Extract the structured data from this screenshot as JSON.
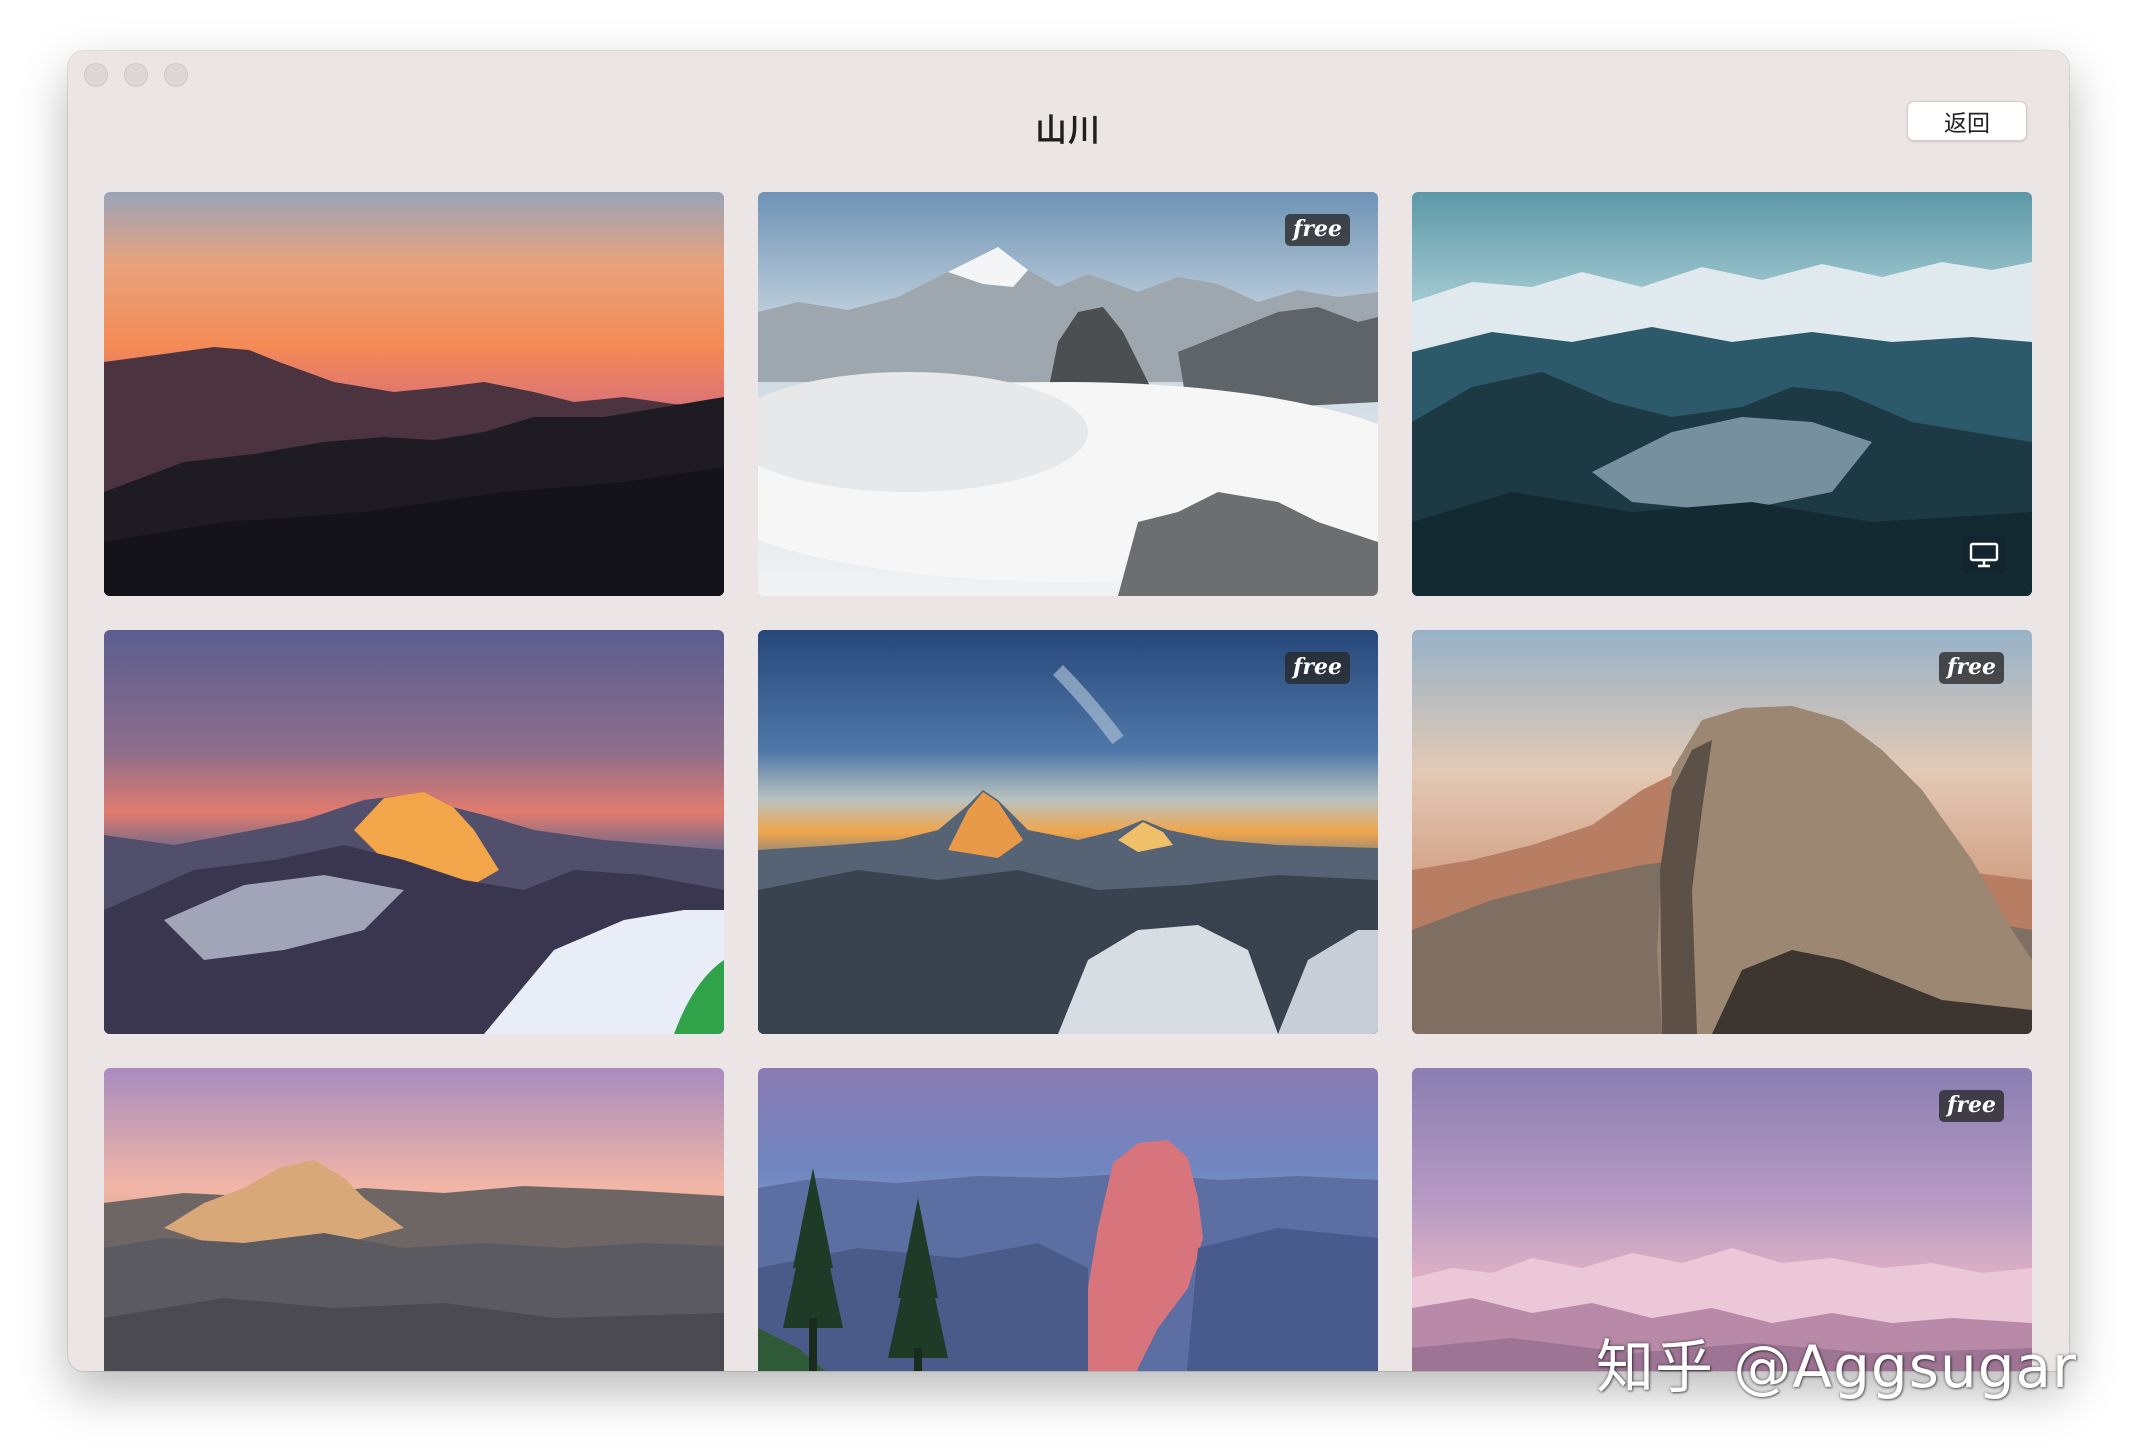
{
  "window": {
    "title": "山川",
    "back_label": "返回"
  },
  "tiles": [
    {
      "id": "sunset-ridges",
      "badge": ""
    },
    {
      "id": "peak-above-clouds",
      "badge": "free"
    },
    {
      "id": "alpine-range",
      "badge": "",
      "icon": "monitor-icon"
    },
    {
      "id": "golden-snow-peak",
      "badge": ""
    },
    {
      "id": "matterhorn-dawn",
      "badge": "free"
    },
    {
      "id": "half-dome-sunset",
      "badge": "free"
    },
    {
      "id": "half-dome-dusk",
      "badge": ""
    },
    {
      "id": "half-dome-alpenglow",
      "badge": ""
    },
    {
      "id": "pink-snow-range",
      "badge": "free"
    }
  ],
  "watermark": "知乎 @Aggsugar"
}
